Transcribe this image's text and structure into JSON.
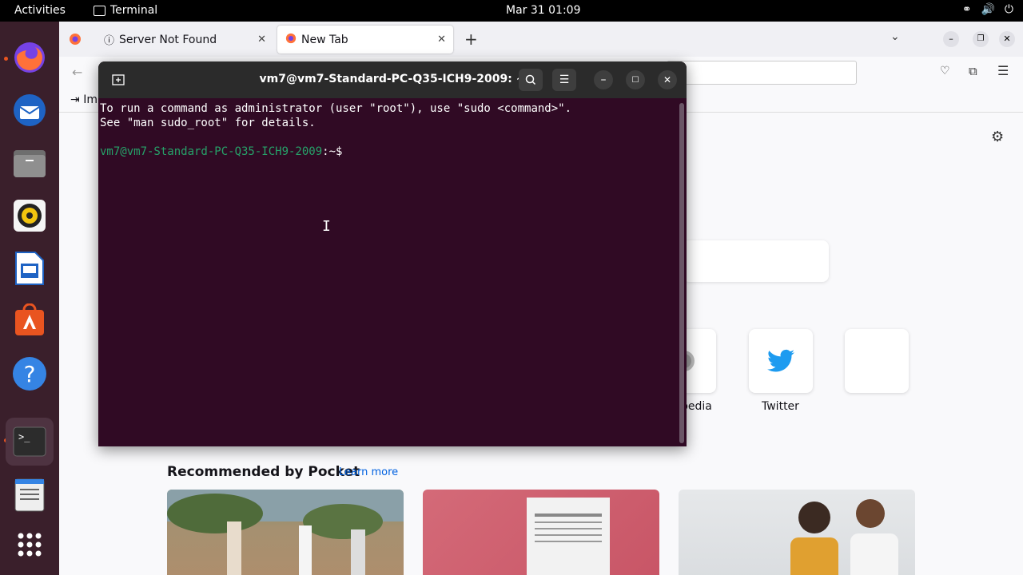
{
  "topbar": {
    "activities": "Activities",
    "app_name": "Terminal",
    "clock": "Mar 31  01:09",
    "tray": [
      "network-icon",
      "volume-icon",
      "power-icon"
    ]
  },
  "dock": {
    "items": [
      "firefox",
      "thunderbird",
      "files",
      "rhythmbox",
      "libreoffice-writer",
      "app-center",
      "help",
      "terminal",
      "text-editor",
      "show-apps"
    ]
  },
  "firefox": {
    "tabs": [
      {
        "label": "Server Not Found"
      },
      {
        "label": "New Tab"
      }
    ],
    "bookmark_partial": "Im",
    "shortcuts": [
      {
        "label": "pedia"
      },
      {
        "label": "Twitter"
      }
    ],
    "pocket": {
      "heading": "Recommended by Pocket",
      "learn_more": "Learn more"
    }
  },
  "terminal": {
    "title": "vm7@vm7-Standard-PC-Q35-ICH9-2009: ~",
    "lines": [
      "To run a command as administrator (user \"root\"), use \"sudo <command>\".",
      "See \"man sudo_root\" for details."
    ],
    "prompt_user": "vm7@vm7-Standard-PC-Q35-ICH9-2009",
    "prompt_suffix": ":~$ "
  },
  "colors": {
    "terminal_bg": "#300a24",
    "prompt_green": "#26a269",
    "ubuntu_orange": "#e95420",
    "dock_bg": "#3a1f2b"
  }
}
